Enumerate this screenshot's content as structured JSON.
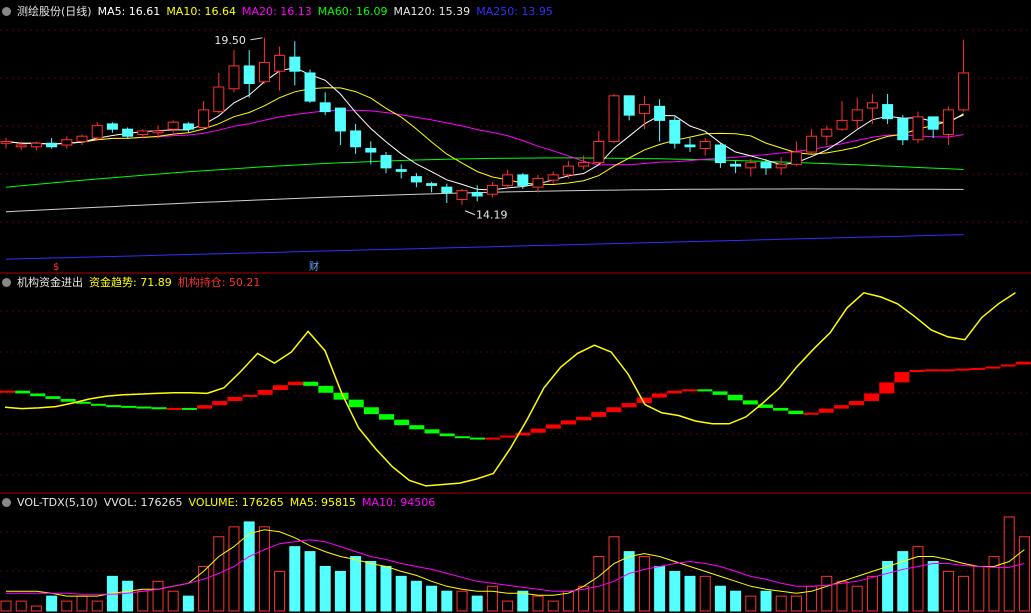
{
  "price_panel": {
    "header": [
      {
        "text": "测绘股份(日线)",
        "color": "#e6e6e6"
      },
      {
        "text": "MA5: 16.61",
        "color": "#ffffff"
      },
      {
        "text": "MA10: 16.64",
        "color": "#ffff00"
      },
      {
        "text": "MA20: 16.13",
        "color": "#ff00ff"
      },
      {
        "text": "MA60: 16.09",
        "color": "#00ff00"
      },
      {
        "text": "MA120: 15.39",
        "color": "#e6e6e6"
      },
      {
        "text": "MA250: 13.95",
        "color": "#3030ff"
      }
    ],
    "high_label": "19.50",
    "low_label": "14.19",
    "markers": [
      {
        "text": "$",
        "color": "#ff3030"
      },
      {
        "text": "财",
        "color": "#66aaff"
      }
    ]
  },
  "fund_panel": {
    "header": [
      {
        "text": "机构资金进出",
        "color": "#e6e6e6"
      },
      {
        "text": "资金趋势: 71.89",
        "color": "#ffff00"
      },
      {
        "text": "机构持仓: 50.21",
        "color": "#ff3030"
      }
    ]
  },
  "vol_panel": {
    "header": [
      {
        "text": "VOL-TDX(5,10)",
        "color": "#e6e6e6"
      },
      {
        "text": "VVOL: 176265",
        "color": "#e6e6e6"
      },
      {
        "text": "VOLUME: 176265",
        "color": "#ffff00"
      },
      {
        "text": "MA5: 95815",
        "color": "#ffff00"
      },
      {
        "text": "MA10: 94506",
        "color": "#ff00ff"
      }
    ]
  },
  "colors": {
    "up": "#ff3030",
    "down": "#54ffff",
    "fund_up": "#ff0000",
    "fund_down": "#00ff00"
  },
  "chart_data": [
    {
      "type": "candlestick",
      "title": "测绘股份(日线)",
      "ylim": [
        13.0,
        20.0
      ],
      "candles": [
        [
          16.55,
          16.6,
          16.7,
          16.4
        ],
        [
          16.45,
          16.5,
          16.6,
          16.35
        ],
        [
          16.45,
          16.55,
          16.6,
          16.35
        ],
        [
          16.55,
          16.45,
          16.7,
          16.4
        ],
        [
          16.5,
          16.65,
          16.75,
          16.4
        ],
        [
          16.6,
          16.75,
          16.8,
          16.5
        ],
        [
          16.7,
          17.05,
          17.15,
          16.65
        ],
        [
          17.1,
          16.95,
          17.15,
          16.85
        ],
        [
          16.95,
          16.75,
          17.0,
          16.7
        ],
        [
          16.8,
          16.9,
          16.95,
          16.7
        ],
        [
          16.85,
          16.9,
          17.05,
          16.7
        ],
        [
          16.95,
          17.15,
          17.2,
          16.85
        ],
        [
          17.1,
          16.95,
          17.15,
          16.85
        ],
        [
          17.0,
          17.5,
          17.75,
          16.95
        ],
        [
          17.45,
          18.15,
          18.55,
          17.4
        ],
        [
          18.1,
          18.75,
          19.2,
          18.0
        ],
        [
          18.75,
          18.25,
          19.2,
          17.85
        ],
        [
          18.3,
          18.85,
          19.55,
          18.25
        ],
        [
          18.6,
          19.05,
          19.3,
          18.05
        ],
        [
          19.0,
          18.6,
          19.45,
          18.2
        ],
        [
          18.55,
          17.75,
          18.65,
          17.7
        ],
        [
          17.7,
          17.45,
          18.0,
          17.35
        ],
        [
          17.55,
          16.9,
          17.5,
          16.5
        ],
        [
          16.9,
          16.45,
          17.1,
          16.25
        ],
        [
          16.4,
          16.3,
          16.6,
          15.95
        ],
        [
          16.2,
          15.85,
          16.3,
          15.7
        ],
        [
          15.8,
          15.75,
          15.95,
          15.55
        ],
        [
          15.6,
          15.45,
          15.7,
          15.3
        ],
        [
          15.4,
          15.35,
          15.45,
          15.15
        ],
        [
          15.3,
          15.15,
          15.4,
          14.85
        ],
        [
          14.95,
          15.2,
          15.25,
          14.8
        ],
        [
          15.15,
          15.05,
          15.35,
          14.9
        ],
        [
          15.1,
          15.35,
          15.45,
          15.0
        ],
        [
          15.35,
          15.65,
          15.8,
          15.25
        ],
        [
          15.65,
          15.35,
          15.7,
          15.25
        ],
        [
          15.3,
          15.55,
          15.65,
          15.15
        ],
        [
          15.5,
          15.65,
          15.75,
          15.4
        ],
        [
          15.65,
          15.9,
          16.05,
          15.55
        ],
        [
          15.9,
          16.0,
          16.2,
          15.8
        ],
        [
          16.0,
          16.6,
          16.9,
          15.95
        ],
        [
          16.6,
          17.9,
          17.95,
          16.55
        ],
        [
          17.9,
          17.35,
          17.9,
          17.2
        ],
        [
          17.4,
          17.65,
          17.9,
          16.95
        ],
        [
          17.6,
          17.2,
          17.8,
          16.6
        ],
        [
          17.2,
          16.55,
          17.3,
          16.4
        ],
        [
          16.5,
          16.45,
          16.7,
          16.3
        ],
        [
          16.4,
          16.6,
          16.7,
          16.2
        ],
        [
          16.5,
          16.0,
          16.55,
          15.85
        ],
        [
          15.95,
          15.9,
          16.05,
          15.7
        ],
        [
          15.85,
          16.0,
          16.1,
          15.6
        ],
        [
          16.0,
          15.85,
          16.1,
          15.65
        ],
        [
          15.85,
          15.95,
          16.15,
          15.65
        ],
        [
          15.95,
          16.3,
          16.6,
          15.9
        ],
        [
          16.3,
          16.75,
          16.95,
          16.25
        ],
        [
          16.75,
          16.95,
          17.05,
          16.5
        ],
        [
          16.95,
          17.2,
          17.75,
          16.9
        ],
        [
          17.2,
          17.5,
          17.85,
          16.95
        ],
        [
          17.55,
          17.7,
          17.95,
          17.1
        ],
        [
          17.65,
          17.25,
          17.95,
          17.1
        ],
        [
          17.25,
          16.65,
          17.35,
          16.5
        ],
        [
          16.65,
          17.3,
          17.45,
          16.55
        ],
        [
          17.3,
          16.95,
          17.3,
          16.7
        ],
        [
          16.8,
          17.5,
          17.6,
          16.5
        ],
        [
          17.5,
          18.55,
          19.5,
          17.45
        ]
      ]
    },
    {
      "type": "bar",
      "title": "机构资金进出",
      "series": [
        {
          "name": "机构持仓",
          "values": [
            1.2,
            1.0,
            0.8,
            0.6,
            0.4,
            0.25,
            0.15,
            0.1,
            0.05,
            0.0,
            -0.05,
            -0.05,
            -0.1,
            0.15,
            0.45,
            0.75,
            0.9,
            1.25,
            1.6,
            1.85,
            1.55,
            1.05,
            0.55,
            0.0,
            -0.5,
            -0.9,
            -1.3,
            -1.6,
            -1.9,
            -2.1,
            -2.2,
            -2.25,
            -2.2,
            -2.05,
            -1.85,
            -1.55,
            -1.25,
            -0.95,
            -0.7,
            -0.35,
            0.0,
            0.3,
            0.7,
            1.0,
            1.2,
            1.3,
            1.15,
            0.9,
            0.5,
            0.2,
            -0.05,
            -0.25,
            -0.5,
            -0.4,
            -0.1,
            0.15,
            0.45,
            1.0,
            1.8,
            2.55,
            2.7,
            2.75,
            2.75,
            2.8,
            2.85,
            2.95,
            3.1,
            3.3
          ]
        },
        {
          "name": "资金趋势",
          "values": [
            0.0,
            -0.1,
            -0.05,
            0.05,
            0.3,
            0.6,
            0.8,
            0.9,
            0.95,
            1.0,
            1.05,
            1.05,
            1.0,
            1.4,
            2.6,
            3.9,
            3.2,
            4.0,
            5.5,
            4.1,
            1.0,
            -1.5,
            -3.0,
            -4.3,
            -5.3,
            -5.7,
            -5.6,
            -5.5,
            -5.2,
            -4.8,
            -3.0,
            -0.9,
            1.4,
            2.9,
            3.9,
            4.5,
            4.0,
            2.4,
            0.2,
            -0.4,
            -0.6,
            -1.0,
            -1.2,
            -1.2,
            -0.7,
            0.3,
            1.4,
            2.9,
            4.2,
            5.4,
            7.2,
            8.3,
            8.0,
            7.5,
            6.6,
            5.6,
            5.1,
            4.9,
            6.5,
            7.5,
            8.3
          ]
        }
      ],
      "ylim": [
        -6,
        8.5
      ]
    },
    {
      "type": "bar",
      "title": "VOL-TDX(5,10)",
      "series": [
        {
          "name": "VOLUME",
          "values": [
            10,
            10,
            5,
            15,
            10,
            15,
            10,
            35,
            30,
            20,
            30,
            20,
            15,
            45,
            75,
            85,
            90,
            85,
            40,
            65,
            60,
            45,
            40,
            55,
            50,
            45,
            35,
            30,
            25,
            20,
            20,
            15,
            25,
            10,
            20,
            15,
            10,
            20,
            25,
            55,
            75,
            60,
            55,
            45,
            40,
            35,
            35,
            25,
            20,
            15,
            20,
            15,
            15,
            25,
            35,
            30,
            25,
            35,
            50,
            60,
            65,
            50,
            40,
            35,
            45,
            55,
            95,
            75
          ]
        },
        {
          "name": "MA5",
          "values": [
            20,
            20,
            20,
            18,
            15,
            15,
            15,
            18,
            20,
            22,
            22,
            25,
            28,
            40,
            55,
            65,
            78,
            82,
            80,
            74,
            66,
            60,
            55,
            52,
            48,
            45,
            40,
            36,
            30,
            25,
            22,
            20,
            20,
            18,
            18,
            16,
            16,
            18,
            25,
            35,
            48,
            55,
            58,
            55,
            50,
            45,
            40,
            35,
            30,
            25,
            22,
            20,
            18,
            20,
            25,
            30,
            35,
            40,
            45,
            50,
            55,
            55,
            52,
            48,
            45,
            45,
            50,
            62
          ]
        },
        {
          "name": "MA10",
          "values": [
            18,
            18,
            18,
            18,
            18,
            17,
            17,
            17,
            18,
            20,
            22,
            25,
            28,
            32,
            38,
            45,
            55,
            62,
            68,
            70,
            72,
            70,
            65,
            60,
            55,
            52,
            48,
            45,
            42,
            38,
            34,
            30,
            28,
            26,
            24,
            22,
            20,
            20,
            22,
            25,
            30,
            38,
            42,
            45,
            48,
            50,
            48,
            45,
            40,
            35,
            32,
            28,
            25,
            25,
            26,
            28,
            30,
            34,
            38,
            42,
            45,
            48,
            48,
            46,
            45,
            44,
            44,
            48
          ]
        }
      ],
      "ylim": [
        0,
        100
      ]
    }
  ]
}
